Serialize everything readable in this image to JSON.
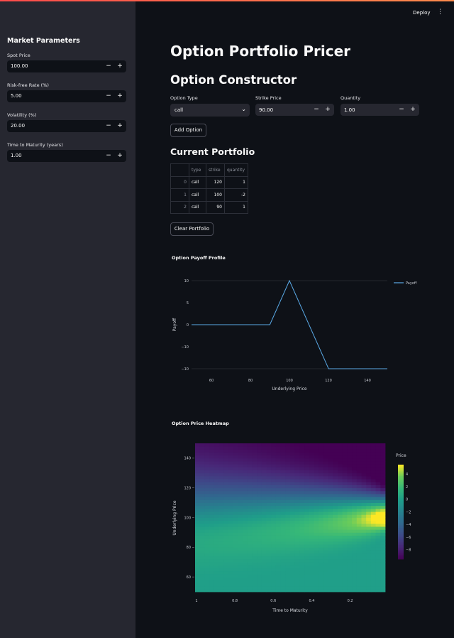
{
  "toolbar": {
    "deploy_label": "Deploy",
    "menu_icon": "⋮"
  },
  "sidebar": {
    "title": "Market Parameters",
    "fields": [
      {
        "label": "Spot Price",
        "value": "100.00"
      },
      {
        "label": "Risk-free Rate (%)",
        "value": "5.00"
      },
      {
        "label": "Volatility (%)",
        "value": "20.00"
      },
      {
        "label": "Time to Maturity (years)",
        "value": "1.00"
      }
    ]
  },
  "main": {
    "title": "Option Portfolio Pricer",
    "constructor": {
      "title": "Option Constructor",
      "option_type_label": "Option Type",
      "option_type_value": "call",
      "strike_label": "Strike Price",
      "strike_value": "90.00",
      "quantity_label": "Quantity",
      "quantity_value": "1.00",
      "add_button": "Add Option"
    },
    "portfolio": {
      "title": "Current Portfolio",
      "columns": [
        "",
        "type",
        "strike",
        "quantity"
      ],
      "rows": [
        [
          "0",
          "call",
          "120",
          "1"
        ],
        [
          "1",
          "call",
          "100",
          "-2"
        ],
        [
          "2",
          "call",
          "90",
          "1"
        ]
      ],
      "clear_button": "Clear Portfolio"
    }
  },
  "chart_data": [
    {
      "type": "line",
      "title": "Option Payoff Profile",
      "xlabel": "Underlying Price",
      "ylabel": "Payoff",
      "x_tick_labels": [
        "60",
        "80",
        "100",
        "120",
        "140"
      ],
      "x_tick_values": [
        60,
        80,
        100,
        120,
        140
      ],
      "y_ticks": [
        10,
        5,
        0,
        -5,
        -10
      ],
      "y_tick_labels": [
        "10",
        "5",
        "0",
        "−10",
        "−10"
      ],
      "xlim": [
        50,
        150
      ],
      "ylim": [
        -10,
        10
      ],
      "series": [
        {
          "name": "Payoff",
          "color": "#5aa9e6",
          "x": [
            50,
            90,
            100,
            120,
            150
          ],
          "values": [
            0,
            0,
            10,
            -10,
            -10
          ]
        }
      ],
      "legend": "top-right",
      "grid": "horizontal"
    },
    {
      "type": "heatmap",
      "title": "Option Price Heatmap",
      "xlabel": "Time to Maturity",
      "ylabel": "Underlying Price",
      "colorbar_title": "Price",
      "x_tick_values": [
        1,
        0.8,
        0.6,
        0.4,
        0.2
      ],
      "x_tick_labels": [
        "1",
        "0.8",
        "0.6",
        "0.4",
        "0.2"
      ],
      "y_tick_values": [
        140,
        120,
        100,
        80,
        60
      ],
      "y_tick_labels": [
        "140",
        "120",
        "100",
        "80",
        "60"
      ],
      "xlim": [
        1,
        0.01
      ],
      "ylim": [
        50,
        150
      ],
      "colorbar_ticks": [
        4,
        2,
        0,
        -2,
        -4,
        -6,
        -8
      ],
      "colorbar_tick_labels": [
        "4",
        "2",
        "0",
        "−2",
        "−4",
        "−6",
        "−8"
      ],
      "zlim": [
        -9.5,
        5.5
      ],
      "colorscale": "viridis"
    }
  ]
}
